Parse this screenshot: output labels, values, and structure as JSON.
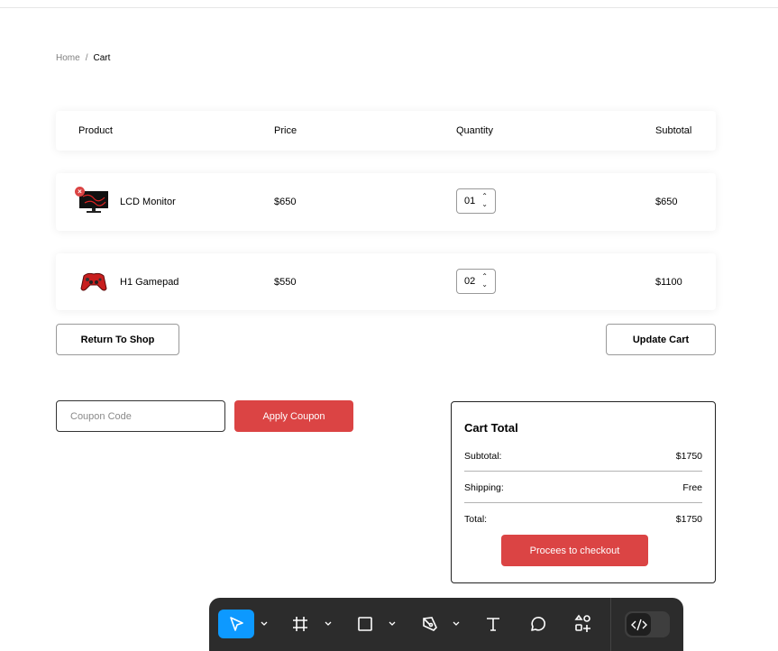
{
  "breadcrumb": {
    "home": "Home",
    "separator": "/",
    "current": "Cart"
  },
  "table": {
    "headers": {
      "product": "Product",
      "price": "Price",
      "quantity": "Quantity",
      "subtotal": "Subtotal"
    },
    "rows": [
      {
        "name": "LCD Monitor",
        "price": "$650",
        "quantity": "01",
        "subtotal": "$650",
        "image": "monitor-image",
        "removable": true
      },
      {
        "name": "H1 Gamepad",
        "price": "$550",
        "quantity": "02",
        "subtotal": "$1100",
        "image": "gamepad-image",
        "removable": false
      }
    ]
  },
  "actions": {
    "return_label": "Return To Shop",
    "update_label": "Update Cart"
  },
  "coupon": {
    "placeholder": "Coupon Code",
    "apply_label": "Apply Coupon"
  },
  "cart_total": {
    "title": "Cart Total",
    "subtotal_label": "Subtotal:",
    "subtotal_value": "$1750",
    "shipping_label": "Shipping:",
    "shipping_value": "Free",
    "total_label": "Total:",
    "total_value": "$1750",
    "checkout_label": "Procees to checkout"
  },
  "colors": {
    "accent": "#db4444",
    "toolbar_bg": "#2c2c2c",
    "tool_active": "#0d99ff"
  },
  "toolbar": {
    "tools": [
      "move-tool-icon",
      "frame-tool-icon",
      "rectangle-tool-icon",
      "pen-tool-icon",
      "text-tool-icon",
      "comment-tool-icon",
      "assets-tool-icon"
    ],
    "dev_mode_icon": "code-icon"
  }
}
